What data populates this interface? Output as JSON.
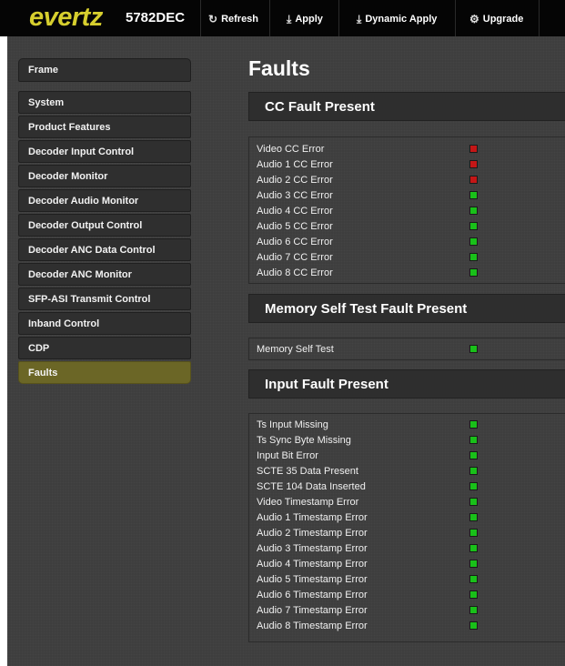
{
  "topbar": {
    "logo": "evertz",
    "model": "5782DEC",
    "buttons": [
      {
        "label": "Refresh",
        "icon": "refresh-icon",
        "glyph": "↻"
      },
      {
        "label": "Apply",
        "icon": "download-icon",
        "glyph": "⤓"
      },
      {
        "label": "Dynamic Apply",
        "icon": "download-icon",
        "glyph": "⤓"
      },
      {
        "label": "Upgrade",
        "icon": "gear-icon",
        "glyph": "⚙"
      }
    ]
  },
  "sidebar": {
    "items": [
      {
        "label": "Frame"
      },
      {
        "label": "System"
      },
      {
        "label": "Product Features"
      },
      {
        "label": "Decoder Input Control"
      },
      {
        "label": "Decoder Monitor"
      },
      {
        "label": "Decoder Audio Monitor"
      },
      {
        "label": "Decoder Output Control"
      },
      {
        "label": "Decoder ANC Data Control"
      },
      {
        "label": "Decoder ANC Monitor"
      },
      {
        "label": "SFP-ASI Transmit Control"
      },
      {
        "label": "Inband Control"
      },
      {
        "label": "CDP"
      },
      {
        "label": "Faults"
      }
    ],
    "active": "Faults"
  },
  "page": {
    "title": "Faults"
  },
  "colors": {
    "ok": "#19c019",
    "fault": "#c41616",
    "accent": "#d7cf2e",
    "active_nav": "#6b6626"
  },
  "sections": [
    {
      "title": "CC Fault Present",
      "rows": [
        {
          "label": "Video CC Error",
          "status": "red"
        },
        {
          "label": "Audio 1 CC Error",
          "status": "red"
        },
        {
          "label": "Audio 2 CC Error",
          "status": "red"
        },
        {
          "label": "Audio 3 CC Error",
          "status": "green"
        },
        {
          "label": "Audio 4 CC Error",
          "status": "green"
        },
        {
          "label": "Audio 5 CC Error",
          "status": "green"
        },
        {
          "label": "Audio 6 CC Error",
          "status": "green"
        },
        {
          "label": "Audio 7 CC Error",
          "status": "green"
        },
        {
          "label": "Audio 8 CC Error",
          "status": "green"
        }
      ]
    },
    {
      "title": "Memory Self Test Fault Present",
      "rows": [
        {
          "label": "Memory Self Test",
          "status": "green"
        }
      ]
    },
    {
      "title": "Input Fault Present",
      "rows": [
        {
          "label": "Ts Input Missing",
          "status": "green"
        },
        {
          "label": "Ts Sync Byte Missing",
          "status": "green"
        },
        {
          "label": "Input Bit Error",
          "status": "green"
        },
        {
          "label": "SCTE 35 Data Present",
          "status": "green"
        },
        {
          "label": "SCTE 104 Data Inserted",
          "status": "green"
        },
        {
          "label": "Video Timestamp Error",
          "status": "green"
        },
        {
          "label": "Audio 1 Timestamp Error",
          "status": "green"
        },
        {
          "label": "Audio 2 Timestamp Error",
          "status": "green"
        },
        {
          "label": "Audio 3 Timestamp Error",
          "status": "green"
        },
        {
          "label": "Audio 4 Timestamp Error",
          "status": "green"
        },
        {
          "label": "Audio 5 Timestamp Error",
          "status": "green"
        },
        {
          "label": "Audio 6 Timestamp Error",
          "status": "green"
        },
        {
          "label": "Audio 7 Timestamp Error",
          "status": "green"
        },
        {
          "label": "Audio 8 Timestamp Error",
          "status": "green"
        }
      ]
    }
  ]
}
